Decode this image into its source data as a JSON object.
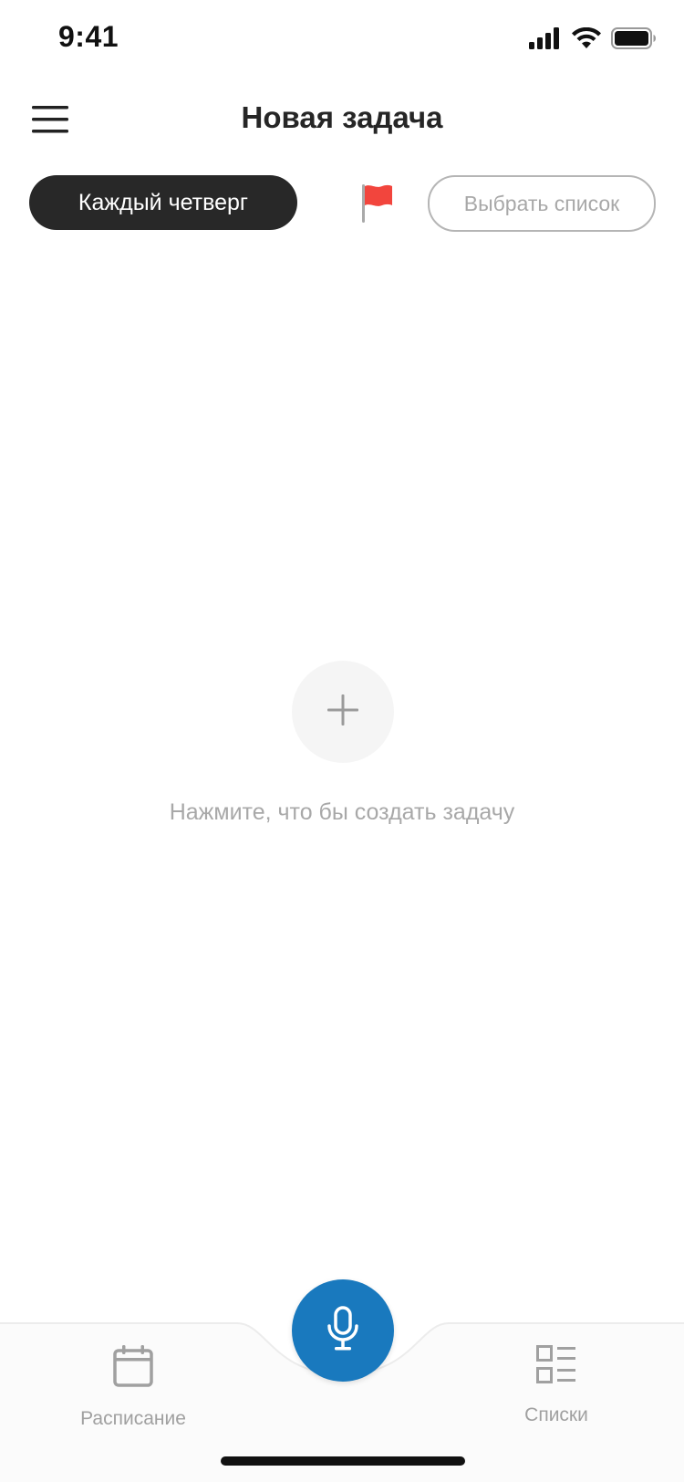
{
  "status_bar": {
    "time": "9:41"
  },
  "header": {
    "title": "Новая задача",
    "menu_icon": "hamburger-menu-icon"
  },
  "chips": {
    "repeat_label": "Каждый четверг",
    "flag_icon": "red-flag-icon",
    "flag_color": "#f2453d",
    "list_label": "Выбрать список"
  },
  "empty_state": {
    "add_icon": "plus-icon",
    "hint": "Нажмите, что бы создать задачу"
  },
  "tab_bar": {
    "tabs": [
      {
        "label": "Расписание",
        "icon": "calendar-icon"
      },
      {
        "label": "Списки",
        "icon": "list-grid-icon"
      }
    ],
    "mic_icon": "microphone-icon"
  },
  "colors": {
    "accent": "#1979be",
    "chip_dark": "#282828",
    "muted_text": "#a8a8a8"
  }
}
